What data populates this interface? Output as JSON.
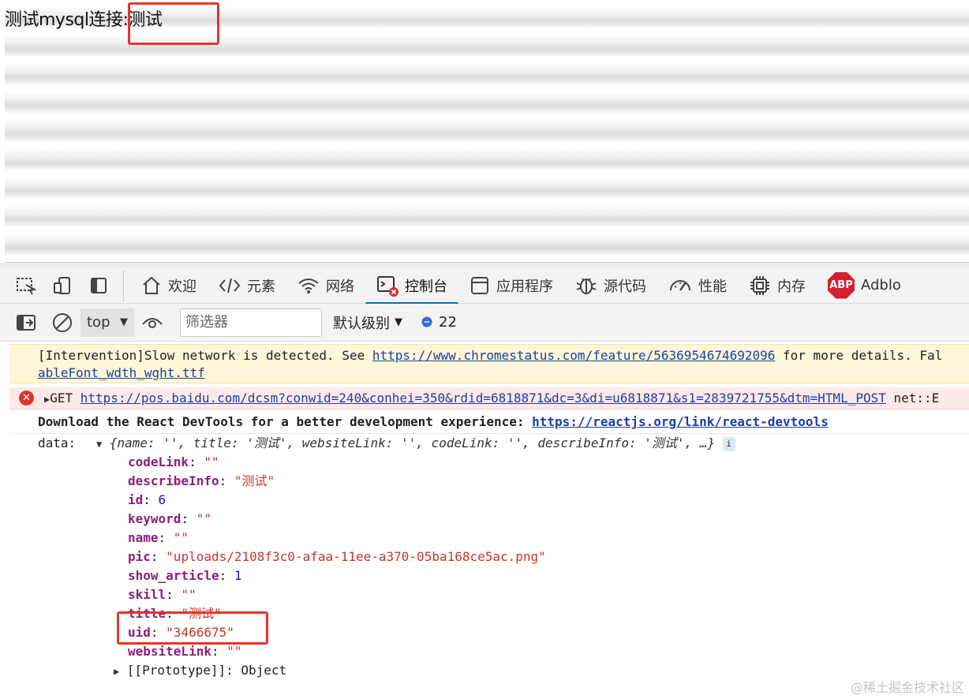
{
  "page": {
    "text": "测试mysql连接:测试"
  },
  "devtools": {
    "tabs": [
      {
        "label": "欢迎",
        "icon": "home-icon"
      },
      {
        "label": "元素",
        "icon": "code-icon"
      },
      {
        "label": "网络",
        "icon": "wifi-icon"
      },
      {
        "label": "控制台",
        "icon": "console-icon"
      },
      {
        "label": "应用程序",
        "icon": "application-icon"
      },
      {
        "label": "源代码",
        "icon": "bug-icon"
      },
      {
        "label": "性能",
        "icon": "performance-icon"
      },
      {
        "label": "内存",
        "icon": "memory-chip-icon"
      },
      {
        "label": "Adblo",
        "icon": "abp-icon"
      }
    ],
    "active_tab": "控制台",
    "abp_label": "ABP",
    "toolbar": {
      "context": "top",
      "filter_placeholder": "筛选器",
      "levels": "默认级别",
      "message_count": "22"
    }
  },
  "console": {
    "warning": {
      "prefix": "[Intervention]Slow network is detected. See ",
      "link": "https://www.chromestatus.com/feature/5636954674692096",
      "suffix": " for more details. Fal",
      "line2": "ableFont_wdth_wght.ttf"
    },
    "error": {
      "method": "GET",
      "url": "https://pos.baidu.com/dcsm?conwid=240&conhei=350&rdid=6818871&dc=3&di=u6818871&s1=2839721755&dtm=HTML_POST",
      "suffix": "net::E"
    },
    "info": {
      "text": "Download the React DevTools for a better development experience: ",
      "link": "https://reactjs.org/link/react-devtools"
    },
    "object": {
      "label": "data:",
      "preview": "{name: '', title: '测试', websiteLink: '', codeLink: '', describeInfo: '测试', …}",
      "props": [
        {
          "key": "codeLink",
          "value": "\"\"",
          "type": "string"
        },
        {
          "key": "describeInfo",
          "value": "\"测试\"",
          "type": "string"
        },
        {
          "key": "id",
          "value": "6",
          "type": "number"
        },
        {
          "key": "keyword",
          "value": "\"\"",
          "type": "string"
        },
        {
          "key": "name",
          "value": "\"\"",
          "type": "string"
        },
        {
          "key": "pic",
          "value": "\"uploads/2108f3c0-afaa-11ee-a370-05ba168ce5ac.png\"",
          "type": "string"
        },
        {
          "key": "show_article",
          "value": "1",
          "type": "number"
        },
        {
          "key": "skill",
          "value": "\"\"",
          "type": "string"
        },
        {
          "key": "title",
          "value": "\"测试\"",
          "type": "string"
        },
        {
          "key": "uid",
          "value": "\"3466675\"",
          "type": "string"
        },
        {
          "key": "websiteLink",
          "value": "\"\"",
          "type": "string"
        }
      ],
      "prototype": "[[Prototype]]: Object"
    }
  },
  "watermark": "@稀土掘金技术社区",
  "colors": {
    "highlight": "#e8342a",
    "active_tab_underline": "#0f6cbd"
  }
}
